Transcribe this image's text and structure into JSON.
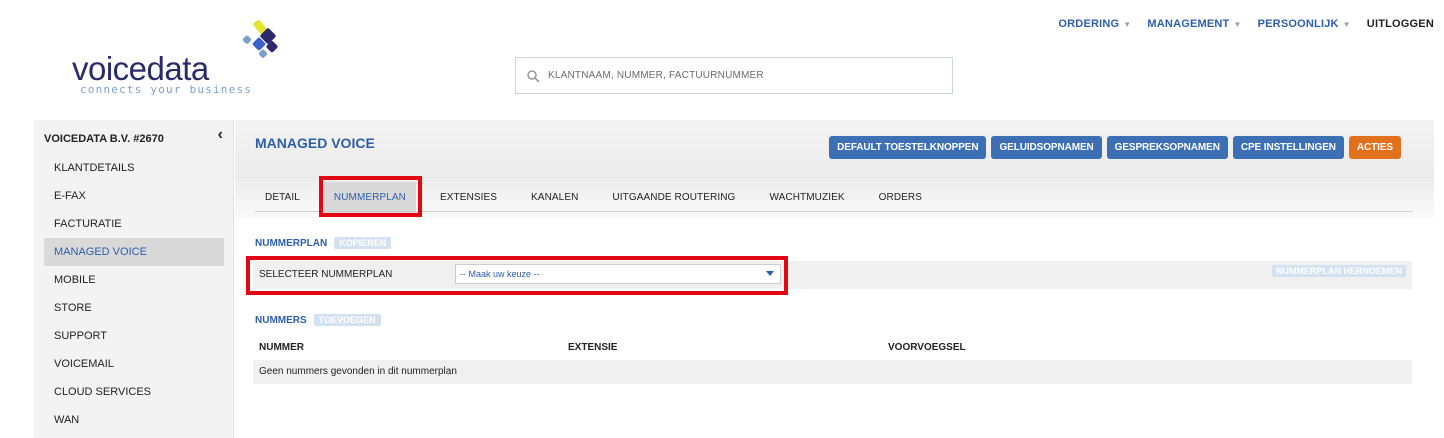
{
  "topnav": {
    "items": [
      {
        "label": "ORDERING",
        "dropdown": true
      },
      {
        "label": "MANAGEMENT",
        "dropdown": true
      },
      {
        "label": "PERSOONLIJK",
        "dropdown": true
      },
      {
        "label": "UITLOGGEN",
        "dropdown": false
      }
    ]
  },
  "logo": {
    "wordmark": "voicedata",
    "tagline": "connects your business"
  },
  "search": {
    "placeholder": "KLANTNAAM, NUMMER, FACTUURNUMMER",
    "value": ""
  },
  "sidebar": {
    "title": "VOICEDATA B.V. #2670",
    "collapse_icon": "chevron-left-icon",
    "items": [
      {
        "label": "KLANTDETAILS",
        "active": false
      },
      {
        "label": "E-FAX",
        "active": false
      },
      {
        "label": "FACTURATIE",
        "active": false
      },
      {
        "label": "MANAGED VOICE",
        "active": true
      },
      {
        "label": "MOBILE",
        "active": false
      },
      {
        "label": "STORE",
        "active": false
      },
      {
        "label": "SUPPORT",
        "active": false
      },
      {
        "label": "VOICEMAIL",
        "active": false
      },
      {
        "label": "CLOUD SERVICES",
        "active": false
      },
      {
        "label": "WAN",
        "active": false
      }
    ]
  },
  "main": {
    "title": "MANAGED VOICE",
    "actions": [
      {
        "label": "DEFAULT TOESTELKNOPPEN",
        "color": "#3c6fb4"
      },
      {
        "label": "GELUIDSOPNAMEN",
        "color": "#3c6fb4"
      },
      {
        "label": "GESPREKSOPNAMEN",
        "color": "#3c6fb4"
      },
      {
        "label": "CPE INSTELLINGEN",
        "color": "#3c6fb4"
      },
      {
        "label": "ACTIES",
        "color": "#e2711d"
      }
    ],
    "tabs": [
      {
        "label": "DETAIL",
        "active": false
      },
      {
        "label": "NUMMERPLAN",
        "active": true
      },
      {
        "label": "EXTENSIES",
        "active": false
      },
      {
        "label": "KANALEN",
        "active": false
      },
      {
        "label": "UITGAANDE ROUTERING",
        "active": false
      },
      {
        "label": "WACHTMUZIEK",
        "active": false
      },
      {
        "label": "ORDERS",
        "active": false
      }
    ],
    "nummerplan": {
      "heading": "NUMMERPLAN",
      "copy_label": "KOPIEREN",
      "select_label": "SELECTEER NUMMERPLAN",
      "select_value": "-- Maak uw keuze --",
      "rename_label": "NUMMERPLAN HERNOEMEN"
    },
    "nummers": {
      "heading": "NUMMERS",
      "add_label": "TOEVOEGEN",
      "columns": [
        "NUMMER",
        "EXTENSIE",
        "VOORVOEGSEL"
      ],
      "empty_message": "Geen nummers gevonden in dit nummerplan"
    }
  },
  "colors": {
    "accent_blue": "#2f5ea8",
    "button_blue": "#3c6fb4",
    "button_orange": "#e2711d",
    "highlight_red": "#e30613"
  }
}
